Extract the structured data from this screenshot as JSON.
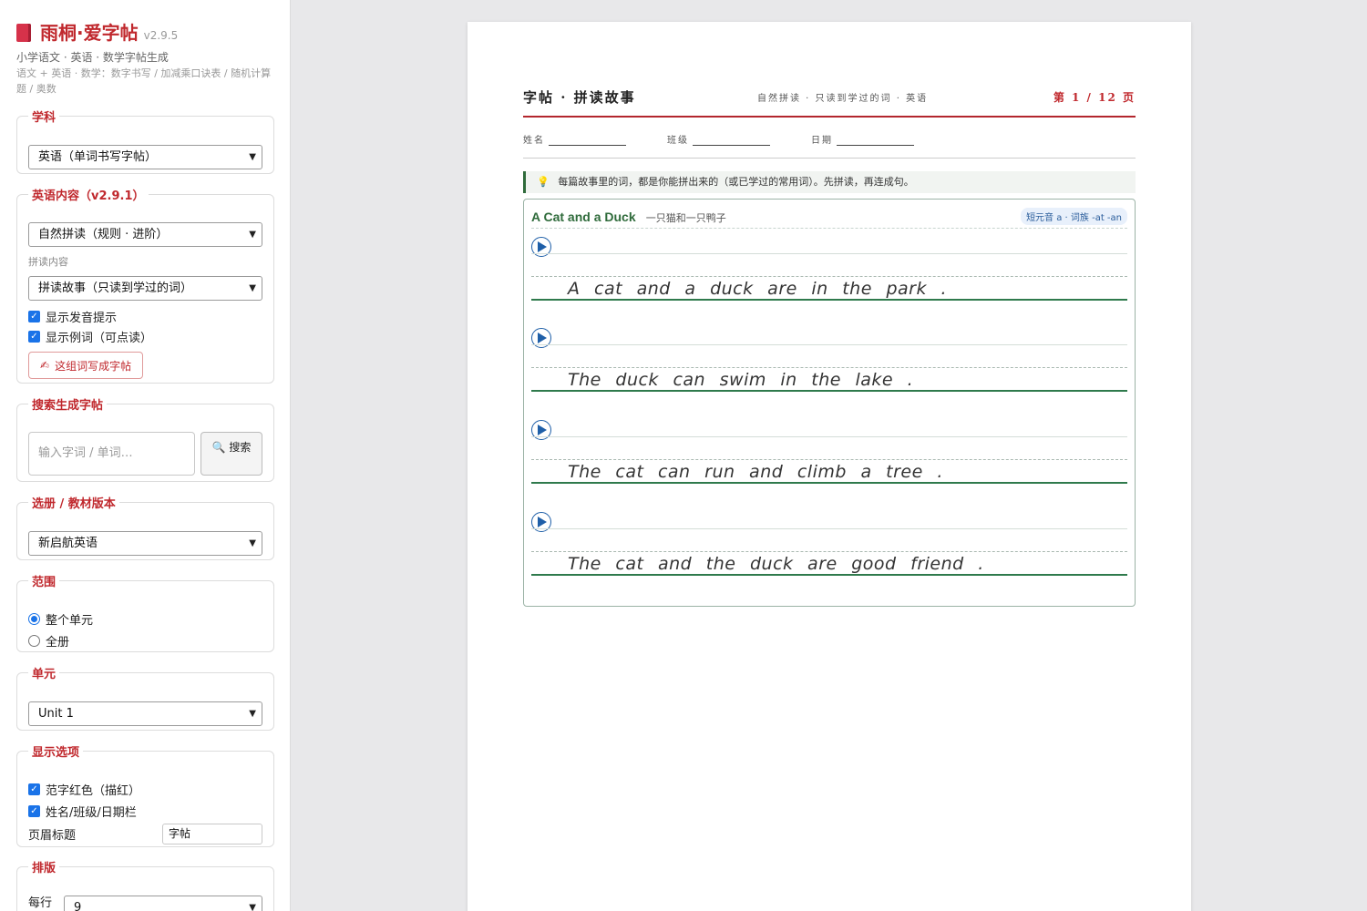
{
  "app": {
    "title": "雨桐·爱字帖",
    "version": "v2.9.5",
    "subtitle": "小学语文 · 英语 · 数学字帖生成",
    "desc": "语文 + 英语 · 数学：数字书写 / 加减乘口诀表 / 随机计算题 / 奥数"
  },
  "sidebar": {
    "subject": {
      "legend": "学科",
      "value": "英语（单词书写字帖）"
    },
    "english_content": {
      "legend": "英语内容（v2.9.1）",
      "mode_value": "自然拼读（规则 · 进阶）",
      "phonics_label": "拼读内容",
      "phonics_value": "拼读故事（只读到学过的词）",
      "check_pron": "显示发音提示",
      "check_example": "显示例词（可点读）",
      "make_button": "这组词写成字帖"
    },
    "search": {
      "legend": "搜索生成字帖",
      "placeholder": "输入字词 / 单词…",
      "button": "搜索"
    },
    "textbook": {
      "legend": "选册 / 教材版本",
      "value": "新启航英语"
    },
    "range": {
      "legend": "范围",
      "opt_unit": "整个单元",
      "opt_all": "全册"
    },
    "unit": {
      "legend": "单元",
      "value": "Unit 1"
    },
    "display": {
      "legend": "显示选项",
      "check_red": "范字红色（描红）",
      "check_name": "姓名/班级/日期栏",
      "header_title_label": "页眉标题",
      "header_title_value": "字帖"
    },
    "layout": {
      "legend": "排版",
      "per_row_label": "每行字",
      "per_row_value": "9"
    }
  },
  "worksheet": {
    "title": "字帖 · 拼读故事",
    "center": "自然拼读 · 只读到学过的词 · 英语",
    "page": "第 1 / 12 页",
    "name_label": "姓名",
    "class_label": "班级",
    "date_label": "日期",
    "tip": "每篇故事里的词，都是你能拼出来的（或已学过的常用词）。先拼读，再连成句。",
    "story": {
      "title": "A Cat and a Duck",
      "subtitle": "一只猫和一只鸭子",
      "tag": "短元音 a · 词族 -at -an",
      "sentences": [
        "A cat and a duck are in the park .",
        "The duck can swim in the lake .",
        "The cat can run and climb a tree .",
        "The cat and the duck are good friend ."
      ]
    }
  },
  "colors": {
    "brand_red": "#c0282d",
    "green": "#2f6b3b",
    "checkbox_blue": "#1a73e8",
    "play_blue": "#1f5fa8"
  },
  "icons": [
    "book-icon",
    "hand-write-icon",
    "magnifier-icon",
    "bulb-icon",
    "play-icon",
    "chevron-down-icon"
  ]
}
